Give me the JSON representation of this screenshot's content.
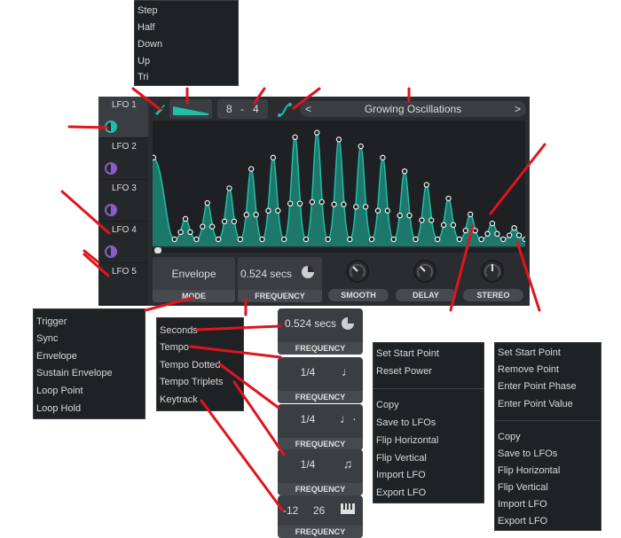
{
  "shape_menu": {
    "items": [
      "Step",
      "Half",
      "Down",
      "Up",
      "Tri"
    ]
  },
  "lfos": [
    {
      "label": "LFO 1",
      "selected": true,
      "indicator": "#1fbfa8"
    },
    {
      "label": "LFO 2",
      "selected": false,
      "indicator": "#8a5cc9"
    },
    {
      "label": "LFO 3",
      "selected": false,
      "indicator": "#8a5cc9"
    },
    {
      "label": "LFO 4",
      "selected": false,
      "indicator": "#8a5cc9"
    },
    {
      "label": "LFO 5",
      "selected": false,
      "indicator": "#8a5cc9"
    }
  ],
  "toolbar": {
    "grid_x": "8",
    "grid_sep": "-",
    "grid_y": "4",
    "preset_name": "Growing Oscillations",
    "prev_arrow": "<",
    "next_arrow": ">"
  },
  "controls": {
    "mode_value": "Envelope",
    "mode_label": "MODE",
    "frequency_value": "0.524 secs",
    "frequency_label": "FREQUENCY",
    "smooth_label": "SMOOTH",
    "delay_label": "DELAY",
    "stereo_label": "STEREO"
  },
  "mode_menu": {
    "items": [
      "Trigger",
      "Sync",
      "Envelope",
      "Sustain Envelope",
      "Loop Point",
      "Loop Hold"
    ]
  },
  "frequency_menu": {
    "items": [
      "Seconds",
      "Tempo",
      "Tempo Dotted",
      "Tempo Triplets",
      "Keytrack"
    ]
  },
  "frequency_cards": [
    {
      "value": "0.524 secs",
      "label": "FREQUENCY",
      "icon": "clock-icon"
    },
    {
      "value": "1/4",
      "label": "FREQUENCY",
      "icon": "quarter-note-icon"
    },
    {
      "value": "1/4",
      "label": "FREQUENCY",
      "icon": "dotted-note-icon"
    },
    {
      "value": "1/4",
      "label": "FREQUENCY",
      "icon": "triplet-notes-icon"
    },
    {
      "value_a": "-12",
      "value_b": "26",
      "label": "FREQUENCY",
      "icon": "keyboard-icon"
    }
  ],
  "graph_menu": {
    "group1": [
      "Set Start Point",
      "Reset Power"
    ],
    "group2": [
      "Copy",
      "Save to LFOs",
      "Flip Horizontal",
      "Flip Vertical",
      "Import LFO",
      "Export LFO"
    ]
  },
  "point_menu": {
    "group1": [
      "Set Start Point",
      "Remove Point",
      "Enter Point Phase",
      "Enter Point Value"
    ],
    "group2": [
      "Copy",
      "Save to LFOs",
      "Flip Horizontal",
      "Flip Vertical",
      "Import LFO",
      "Export LFO"
    ]
  },
  "colors": {
    "accent": "#1fbfa8",
    "annotation": "#e0141e",
    "panel": "#2a2d30"
  },
  "lfo_peaks": [
    0.72,
    0.18,
    0.32,
    0.45,
    0.62,
    0.72,
    0.9,
    0.94,
    0.88,
    0.82,
    0.72,
    0.6,
    0.48,
    0.36,
    0.22,
    0.14,
    0.1
  ]
}
